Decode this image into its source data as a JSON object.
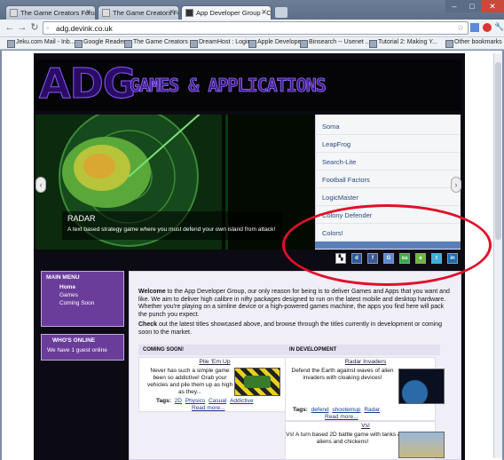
{
  "browser": {
    "tabs": [
      {
        "title": "The Game Creators Forum"
      },
      {
        "title": "The Game Creators Forum"
      },
      {
        "title": "App Developer Group - Cul"
      }
    ],
    "url": "adg.devink.co.uk",
    "other_bookmarks": "Other bookmarks",
    "bookmarks": [
      "Jeku.com Mail - Inb...",
      "Google Reader",
      "The Game Creators ...",
      "DreamHost : Login",
      "Apple Developer",
      "Binsearch -- Usenet ...",
      "Tutorial 2: Making Y..."
    ]
  },
  "site": {
    "logo": "ADG",
    "subtitle": "GAMES & APPLICATIONS",
    "slider": {
      "caption_title": "RADAR",
      "caption_text": "A text based strategy game where you must defend your own island from attack!",
      "items": [
        "Soma",
        "LeapFrog",
        "Search-Lite",
        "Football Factors",
        "LogicMaster",
        "Colony Defender",
        "Colors!",
        ""
      ]
    },
    "social_icons": [
      "delicious-icon",
      "digg-icon",
      "facebook-icon",
      "google-icon",
      "stumbleupon-icon",
      "evernote-icon",
      "twitter-icon",
      "linkedin-icon"
    ],
    "main_menu": {
      "title": "MAIN MENU",
      "items": [
        "Home",
        "Games",
        "Coming Soon"
      ]
    },
    "whos_online": {
      "title": "WHO'S ONLINE",
      "text": "We have 1 guest online"
    },
    "intro": {
      "welcome": "Welcome",
      "text": " to the App Developer Group, our only reason for being is to deliver Games and Apps that you want and like. We aim to deliver high calibre in nifty packages designed to run on the latest mobile and desktop hardware. Whether you're playing on a simline device or a high-powered games machine, the apps you find here will pack the punch you expect.",
      "check": "Check",
      "text2": " out the latest titles showcased above, and browse through the titles currently in development or coming soon to the market."
    },
    "coming_soon": {
      "heading": "COMING SOON!",
      "game": {
        "title": "Pile 'Em Up",
        "desc": "Never has such a simple game been so addictive! Grab your vehicles and pile them up as high as they...",
        "tags_label": "Tags:",
        "tags": [
          "2D",
          "Physics",
          "Casual",
          "Addictive"
        ],
        "more": "Read more..."
      }
    },
    "in_development": {
      "heading": "IN DEVELOPMENT",
      "games": [
        {
          "title": "Radar Invaders",
          "desc": "Defend the Earth against waves of alien invaders with cloaking devices!",
          "tags_label": "Tags:",
          "tags": [
            "defend",
            "shootemup",
            "Radar"
          ],
          "more": "Read more..."
        },
        {
          "title": "Vs!",
          "desc": "Vs! A turn based 2D battle game with tanks / aliens and chickens!"
        }
      ]
    }
  }
}
